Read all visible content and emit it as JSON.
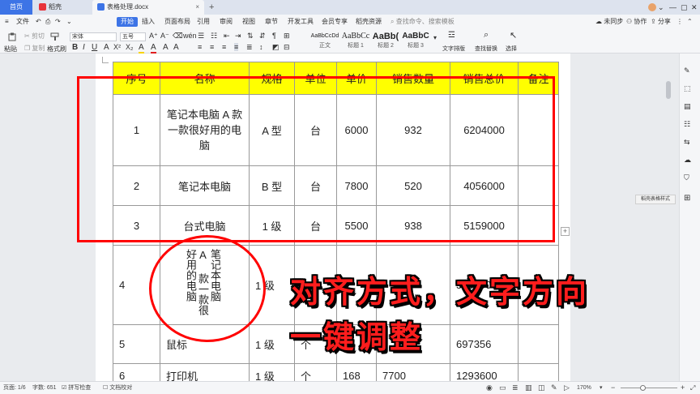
{
  "tabs": {
    "home": "首页",
    "wps": "稻壳",
    "doc": "表格处理.docx",
    "close": "×",
    "add": "+"
  },
  "menu": {
    "file": "文件",
    "items": [
      "开始",
      "插入",
      "页面布局",
      "引用",
      "审阅",
      "视图",
      "章节",
      "开发工具",
      "会员专享",
      "稻壳资源"
    ],
    "search": "查找命令、搜索模板",
    "unsynced": "未同步",
    "collab": "协作",
    "share": "分享"
  },
  "ribbon": {
    "paste": "粘贴",
    "cut": "剪切",
    "copy": "复制",
    "format_painter": "格式刷",
    "font_name": "宋体",
    "font_size": "五号",
    "styles": [
      {
        "sample": "AaBbCcDd",
        "name": "正文"
      },
      {
        "sample": "AaBbCc",
        "name": "标题 1"
      },
      {
        "sample": "AaBb(",
        "name": "标题 2"
      },
      {
        "sample": "AaBbC",
        "name": "标题 3"
      }
    ],
    "text_layout": "文字排版",
    "find_replace": "查找替换",
    "select": "选择"
  },
  "table": {
    "headers": [
      "序号",
      "名称",
      "规格",
      "单位",
      "单价",
      "销售数量",
      "销售总价",
      "备注"
    ],
    "rows": [
      {
        "no": "1",
        "name": "笔记本电脑 A 款一款很好用的电脑",
        "spec": "A 型",
        "unit": "台",
        "price": "6000",
        "qty": "932",
        "total": "6204000"
      },
      {
        "no": "2",
        "name": "笔记本电脑",
        "spec": "B 型",
        "unit": "台",
        "price": "7800",
        "qty": "520",
        "total": "4056000"
      },
      {
        "no": "3",
        "name": "台式电脑",
        "spec": "1 级",
        "unit": "台",
        "price": "5500",
        "qty": "938",
        "total": "5159000"
      },
      {
        "no": "4",
        "name": "笔记本电脑 A 款一款很好用的电脑",
        "spec": "1 级",
        "unit": "",
        "price": "",
        "qty": "",
        "total": "5159000"
      },
      {
        "no": "5",
        "name": "鼠标",
        "spec": "1 级",
        "unit": "个",
        "price": "",
        "qty": "",
        "total": "697356"
      },
      {
        "no": "6",
        "name": "打印机",
        "spec": "1 级",
        "unit": "个",
        "price": "168",
        "qty": "7700",
        "total": "1293600"
      }
    ]
  },
  "captions": {
    "line1": "对齐方式，文字方向",
    "line2": "一键调整"
  },
  "tooltip": "稻壳表格样式",
  "status": {
    "page": "页面: 1/6",
    "words": "字数: 651",
    "spell": "拼写检查",
    "proof": "文档校对",
    "zoom": "170%"
  },
  "colors": {
    "accent": "#3d74e6",
    "header_fill": "#ffff00",
    "annotation": "#ff0000"
  }
}
